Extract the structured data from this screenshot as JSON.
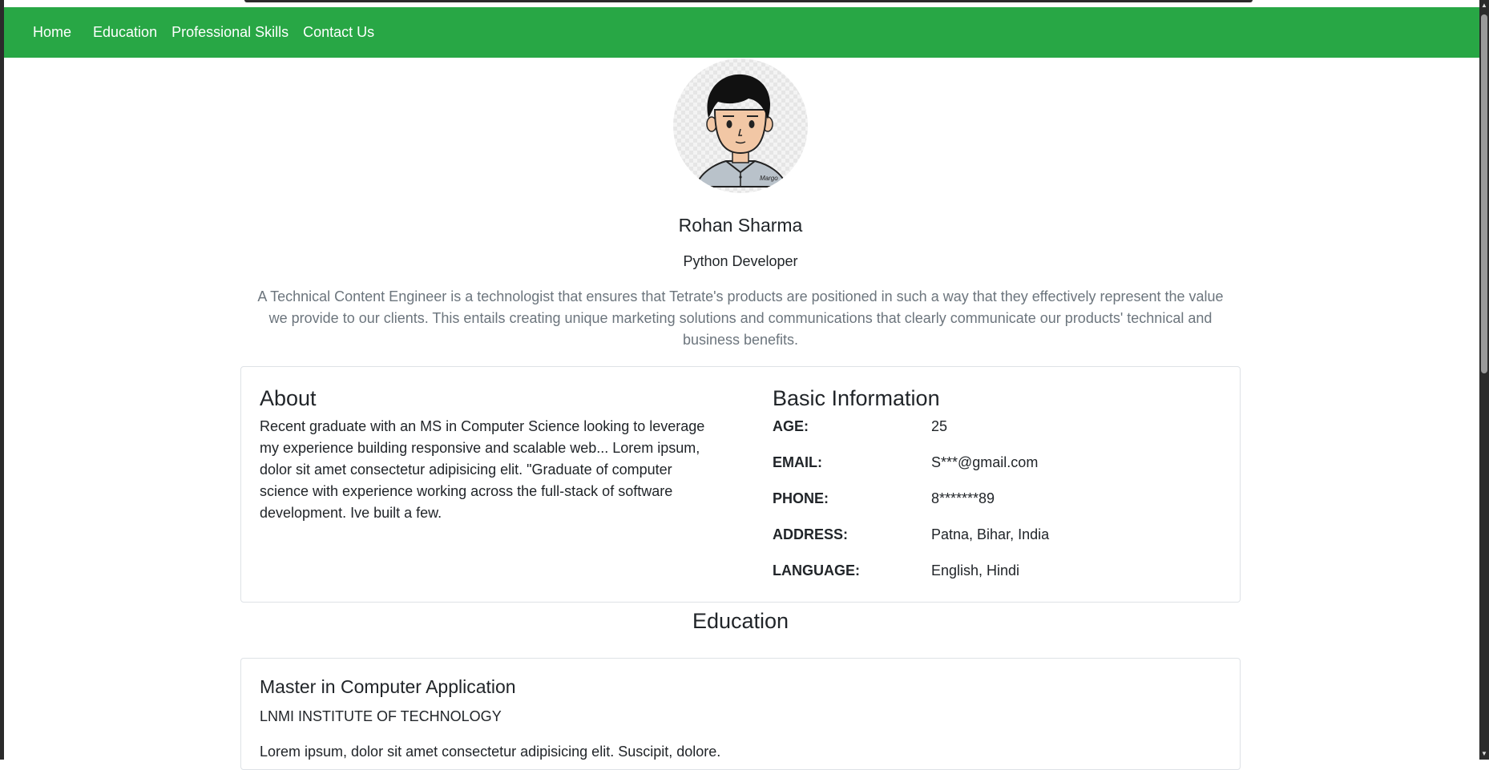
{
  "nav": {
    "items": [
      "Home",
      "Education",
      "Professional Skills",
      "Contact Us"
    ]
  },
  "profile": {
    "name": "Rohan Sharma",
    "role": "Python Developer",
    "summary": "A Technical Content Engineer is a technologist that ensures that Tetrate's products are positioned in such a way that they effectively represent the value we provide to our clients. This entails creating unique marketing solutions and communications that clearly communicate our products' technical and business benefits."
  },
  "about": {
    "title": "About",
    "text": "Recent graduate with an MS in Computer Science looking to leverage my experience building responsive and scalable web... Lorem ipsum, dolor sit amet consectetur adipisicing elit. \"Graduate of computer science with experience working across the full-stack of software development. Ive built a few."
  },
  "basic_info": {
    "title": "Basic Information",
    "rows": [
      {
        "label": "AGE:",
        "value": "25"
      },
      {
        "label": "EMAIL:",
        "value": "S***@gmail.com"
      },
      {
        "label": "PHONE:",
        "value": "8*******89"
      },
      {
        "label": "ADDRESS:",
        "value": "Patna, Bihar, India"
      },
      {
        "label": "LANGUAGE:",
        "value": "English, Hindi"
      }
    ]
  },
  "education": {
    "title": "Education",
    "items": [
      {
        "degree": "Master in Computer Application",
        "institute": "LNMI INSTITUTE OF TECHNOLOGY",
        "description": "Lorem ipsum, dolor sit amet consectetur adipisicing elit. Suscipit, dolore."
      }
    ]
  },
  "colors": {
    "nav_bg": "#28a745",
    "muted_text": "#6c757d"
  },
  "avatar_shirt_text": "Margo"
}
